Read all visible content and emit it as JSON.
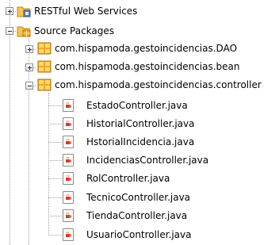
{
  "tree": {
    "nodes": [
      {
        "label": "RESTful Web Services",
        "icon": "web-services-folder-icon",
        "expanded": false
      },
      {
        "label": "Source Packages",
        "icon": "source-packages-folder-icon",
        "expanded": true
      },
      {
        "label": "com.hispamoda.gestoincidencias.DAO",
        "icon": "package-icon",
        "expanded": false
      },
      {
        "label": "com.hispamoda.gestoincidencias.bean",
        "icon": "package-icon",
        "expanded": false
      },
      {
        "label": "com.hispamoda.gestoincidencias.controller",
        "icon": "package-icon",
        "expanded": true
      }
    ],
    "files": [
      {
        "label": "EstadoController.java",
        "icon": "java-class-icon"
      },
      {
        "label": "HistorialController.java",
        "icon": "java-class-icon"
      },
      {
        "label": "HstorialIncidencia.java",
        "icon": "java-class-icon"
      },
      {
        "label": "IncidenciasController.java",
        "icon": "java-class-icon"
      },
      {
        "label": "RolController.java",
        "icon": "java-class-icon"
      },
      {
        "label": "TecnicoController.java",
        "icon": "java-class-icon"
      },
      {
        "label": "TiendaController.java",
        "icon": "java-class-icon"
      },
      {
        "label": "UsuarioController.java",
        "icon": "java-class-icon"
      }
    ]
  },
  "colors": {
    "package_orange": "#f0a830",
    "package_yellow": "#ffd766",
    "folder_yellow": "#f6c453",
    "java_red": "#d33b2c",
    "guide_gray": "#a0a0a0"
  }
}
